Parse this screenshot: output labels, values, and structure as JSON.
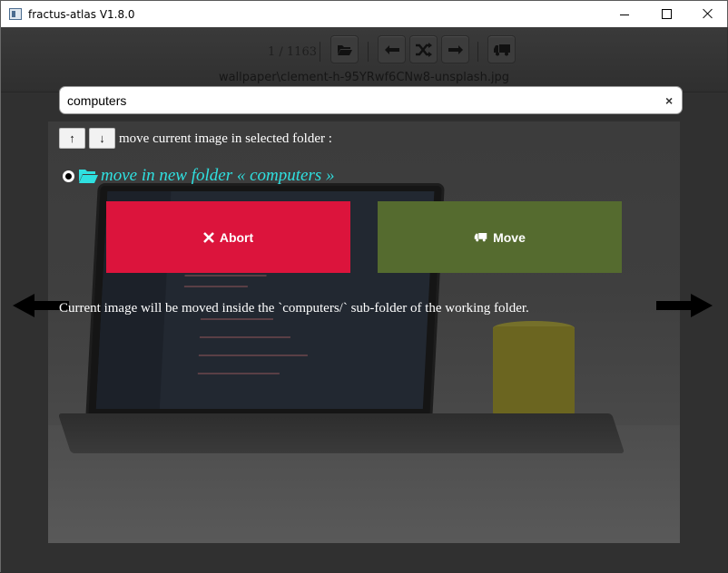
{
  "window": {
    "title": "fractus-atlas V1.8.0"
  },
  "toolbar": {
    "counter": "1 / 1163",
    "buttons": [
      {
        "name": "open-folder",
        "icon": "folder-open-icon"
      },
      {
        "name": "previous",
        "icon": "arrow-left-icon"
      },
      {
        "name": "shuffle",
        "icon": "shuffle-icon"
      },
      {
        "name": "next",
        "icon": "arrow-right-icon"
      },
      {
        "name": "move",
        "icon": "truck-icon"
      }
    ],
    "filename": "wallpaper\\clement-h-95YRwf6CNw8-unsplash.jpg"
  },
  "search": {
    "value": "computers",
    "clear_label": "×"
  },
  "move_panel": {
    "up_label": "↑",
    "down_label": "↓",
    "caption": "move current image in selected folder :",
    "option_label": "move in new folder « computers »",
    "option_selected": true,
    "abort_label": "Abort",
    "move_label": "Move",
    "info": "Current image will be moved inside the `computers/` sub-folder of the working folder."
  },
  "colors": {
    "abort": "#dc143c",
    "move": "#556b2f",
    "option_text": "#2fe0e0"
  }
}
